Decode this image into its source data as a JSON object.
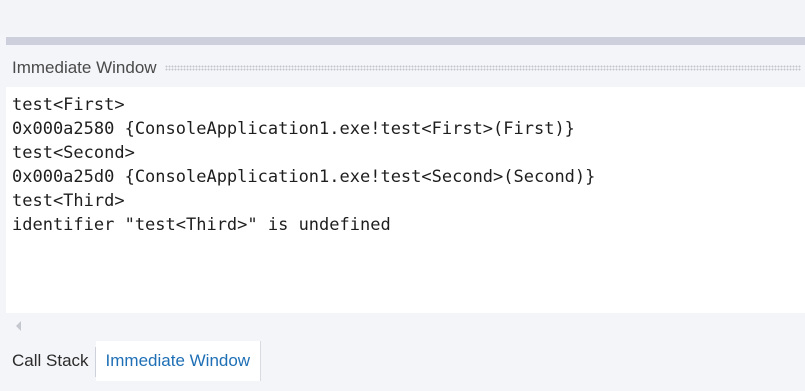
{
  "window": {
    "title": "Immediate Window"
  },
  "output": {
    "lines": [
      "test<First>",
      "0x000a2580 {ConsoleApplication1.exe!test<First>(First)}",
      "test<Second>",
      "0x000a25d0 {ConsoleApplication1.exe!test<Second>(Second)}",
      "test<Third>",
      "identifier \"test<Third>\" is undefined"
    ]
  },
  "tabs": [
    {
      "label": "Call Stack",
      "active": false
    },
    {
      "label": "Immediate Window",
      "active": true
    }
  ],
  "icons": {
    "scroll_left": "scroll-left-icon"
  },
  "colors": {
    "active_tab_text": "#1e6fb5",
    "panel_background": "#f4f5f9",
    "editor_background": "#ffffff"
  }
}
